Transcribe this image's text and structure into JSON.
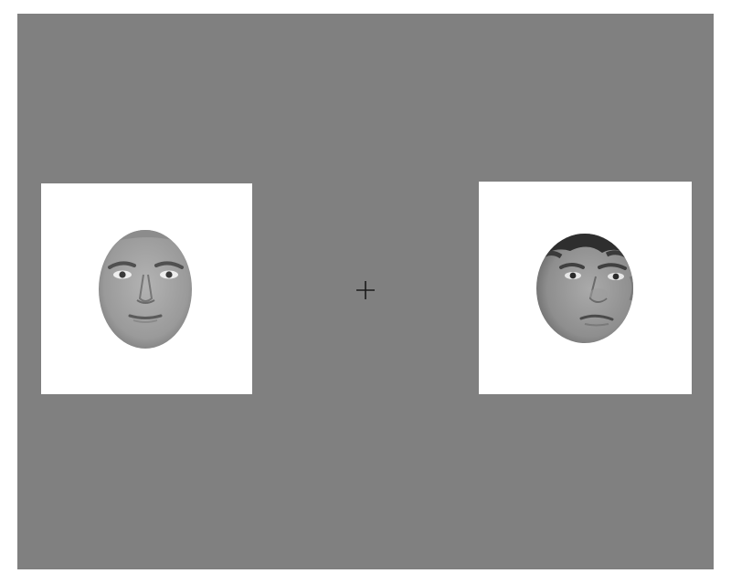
{
  "screen": {
    "background_color": "#808080",
    "frame_color": "#ffffff"
  },
  "stimuli": {
    "left_face": {
      "image": "grayscale-face-photo",
      "expression": "neutral"
    },
    "right_face": {
      "image": "grayscale-face-photo",
      "expression": "sad"
    }
  },
  "fixation": {
    "symbol": "+",
    "color": "#1a1a1a"
  }
}
